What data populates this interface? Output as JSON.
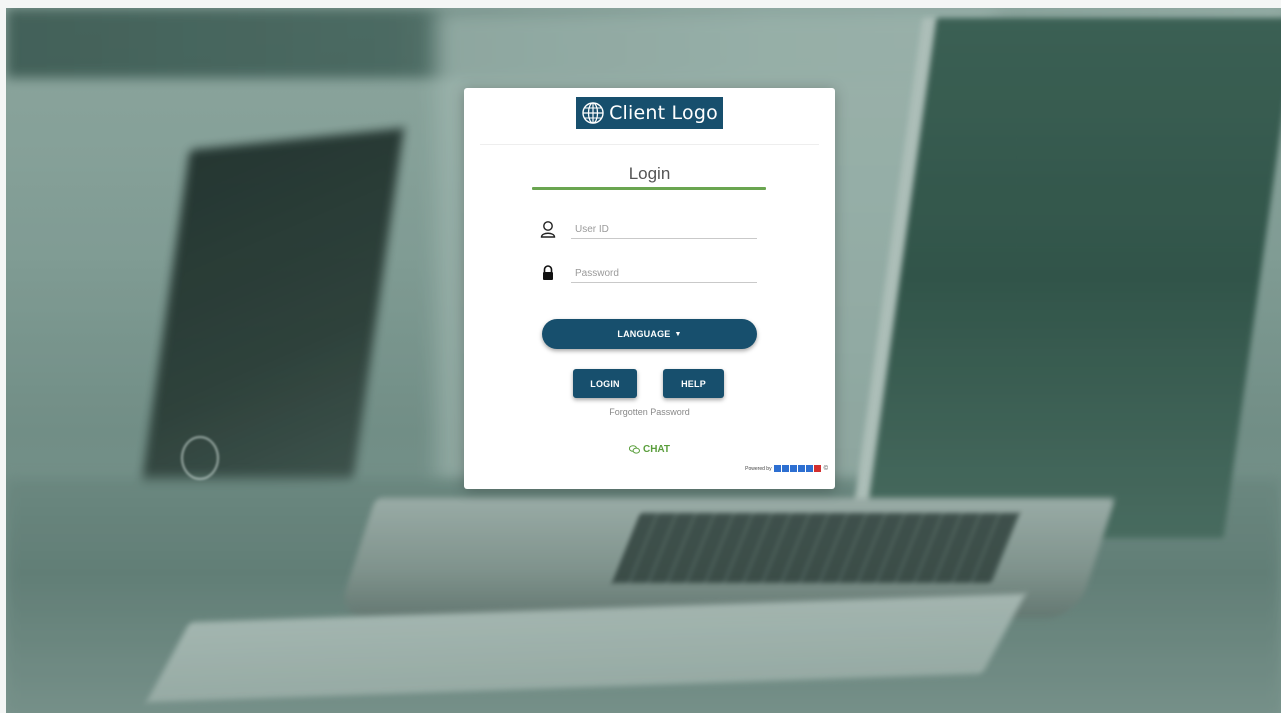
{
  "logo": {
    "text": "Client Logo",
    "background": "#174f6d",
    "icon": "globe-icon"
  },
  "form": {
    "title": "Login",
    "accent_color": "#6aa550",
    "user_field": {
      "placeholder": "User ID",
      "icon": "user-icon"
    },
    "password_field": {
      "placeholder": "Password",
      "icon": "lock-icon"
    }
  },
  "buttons": {
    "language": "LANGUAGE",
    "login": "LOGIN",
    "help": "HELP",
    "primary_color": "#174f6d"
  },
  "links": {
    "forgot_password": "Forgotten Password",
    "chat": "CHAT",
    "chat_color": "#5a9e3c"
  },
  "footer": {
    "powered_by": "Powered by",
    "copyright_symbol": "©"
  }
}
